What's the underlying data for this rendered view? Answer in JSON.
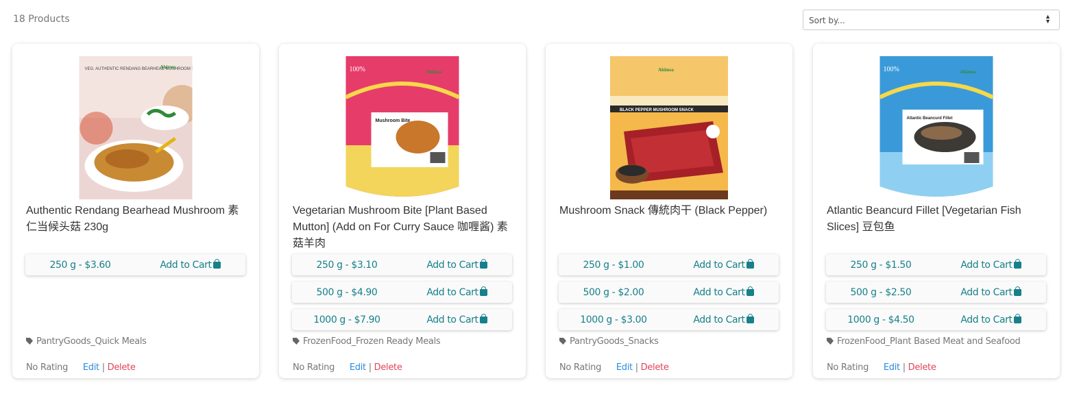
{
  "header": {
    "product_count": "18 Products",
    "sort_placeholder": "Sort by..."
  },
  "colors": {
    "accent": "#17808a",
    "edit_link": "#2a8be0",
    "delete_link": "#e0455a"
  },
  "products": [
    {
      "title": "Authentic Rendang Bearhead Mushroom 素仁当候头菇 230g",
      "image_label": "VEG. AUTHENTIC RENDANG BEARHEAD MUSHROOM 素仁当候头菇",
      "image_brand": "Ahimsa",
      "variants": [
        {
          "price": "250 g - $3.60",
          "cart": "Add to Cart"
        }
      ],
      "category": "PantryGoods_Quick Meals",
      "rating": "No Rating",
      "edit": "Edit",
      "separator": "|",
      "delete": "Delete"
    },
    {
      "title": "Vegetarian Mushroom Bite [Plant Based Mutton] (Add on For Curry Sauce 咖喱酱) 素菇羊肉",
      "image_label": "Mushroom Bite",
      "image_brand": "Ahimsa",
      "variants": [
        {
          "price": "250 g - $3.10",
          "cart": "Add to Cart"
        },
        {
          "price": "500 g - $4.90",
          "cart": "Add to Cart"
        },
        {
          "price": "1000 g - $7.90",
          "cart": "Add to Cart"
        }
      ],
      "category": "FrozenFood_Frozen Ready Meals",
      "rating": "No Rating",
      "edit": "Edit",
      "separator": "|",
      "delete": "Delete"
    },
    {
      "title": "Mushroom Snack 傳統肉干 (Black Pepper)",
      "image_label": "BLACK PEPPER MUSHROOM SNACK",
      "image_brand": "Ahimsa",
      "variants": [
        {
          "price": "250 g - $1.00",
          "cart": "Add to Cart"
        },
        {
          "price": "500 g - $2.00",
          "cart": "Add to Cart"
        },
        {
          "price": "1000 g - $3.00",
          "cart": "Add to Cart"
        }
      ],
      "category": "PantryGoods_Snacks",
      "rating": "No Rating",
      "edit": "Edit",
      "separator": "|",
      "delete": "Delete"
    },
    {
      "title": "Atlantic Beancurd Fillet [Vegetarian Fish Slices] 豆包鱼",
      "image_label": "Atlantic Beancurd Fillet",
      "image_brand": "Ahimsa",
      "variants": [
        {
          "price": "250 g - $1.50",
          "cart": "Add to Cart"
        },
        {
          "price": "500 g - $2.50",
          "cart": "Add to Cart"
        },
        {
          "price": "1000 g - $4.50",
          "cart": "Add to Cart"
        }
      ],
      "category": "FrozenFood_Plant Based Meat and Seafood",
      "rating": "No Rating",
      "edit": "Edit",
      "separator": "|",
      "delete": "Delete"
    }
  ]
}
